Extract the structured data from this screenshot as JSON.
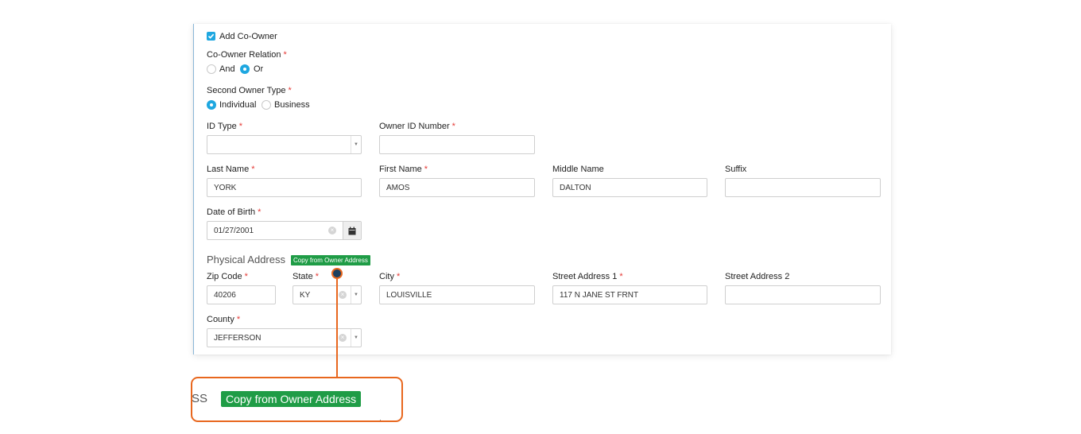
{
  "form": {
    "add_co_owner": {
      "label": "Add Co-Owner",
      "checked": true
    },
    "co_owner_relation": {
      "label": "Co-Owner Relation",
      "options": [
        "And",
        "Or"
      ],
      "selected": "Or"
    },
    "second_owner_type": {
      "label": "Second Owner Type",
      "options": [
        "Individual",
        "Business"
      ],
      "selected": "Individual"
    },
    "id_type": {
      "label": "ID Type",
      "value": ""
    },
    "owner_id_number": {
      "label": "Owner ID Number",
      "value": ""
    },
    "last_name": {
      "label": "Last Name",
      "value": "YORK"
    },
    "first_name": {
      "label": "First Name",
      "value": "AMOS"
    },
    "middle_name": {
      "label": "Middle Name",
      "value": "DALTON"
    },
    "suffix": {
      "label": "Suffix",
      "value": ""
    },
    "date_of_birth": {
      "label": "Date of Birth",
      "value": "01/27/2001"
    },
    "physical_address": {
      "title": "Physical Address",
      "copy_button": "Copy from Owner Address",
      "zip_code": {
        "label": "Zip Code",
        "value": "40206"
      },
      "state": {
        "label": "State",
        "value": "KY"
      },
      "city": {
        "label": "City",
        "value": "LOUISVILLE"
      },
      "street_address_1": {
        "label": "Street Address 1",
        "value": "117 N JANE ST FRNT"
      },
      "street_address_2": {
        "label": "Street Address 2",
        "value": ""
      },
      "county": {
        "label": "County",
        "value": "JEFFERSON"
      }
    }
  },
  "zoom_callout": {
    "partial_text": "SS",
    "button_label": "Copy from Owner Address"
  },
  "icons": {
    "checkbox": "check-icon",
    "calendar": "calendar-icon",
    "clear": "clear-icon",
    "dropdown": "chevron-down-icon"
  },
  "colors": {
    "accent_blue": "#1ea7e0",
    "button_green": "#1f9c46",
    "callout_orange": "#e8671e",
    "required_red": "#e53935"
  }
}
